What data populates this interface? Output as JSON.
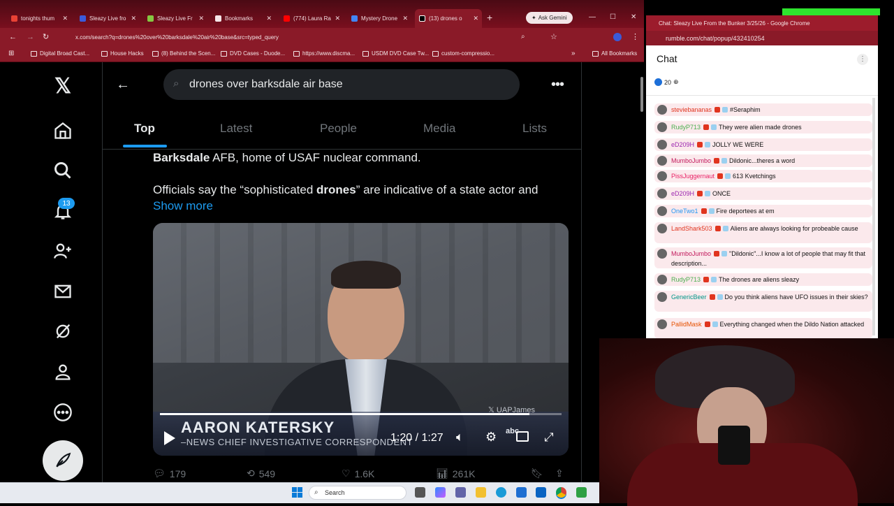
{
  "tabs": [
    {
      "label": "tonights thum",
      "color": "#e94235"
    },
    {
      "label": "Sleazy Live fro",
      "color": "#3b5bdb"
    },
    {
      "label": "Sleazy Live Fr",
      "color": "#85c742"
    },
    {
      "label": "Bookmarks",
      "color": "#f4e6e8"
    },
    {
      "label": "(774) Laura Ra",
      "color": "#ff0000"
    },
    {
      "label": "Mystery Drone",
      "color": "#4285f4"
    },
    {
      "label": "(13) drones o",
      "color": "#000000"
    }
  ],
  "ask_gemini": "Ask Gemini",
  "address": "x.com/search?q=drones%20over%20barksdale%20air%20base&src=typed_query",
  "bookmarks": [
    "Digital Broad Cast...",
    "House Hacks",
    "(8) Behind the Scen...",
    "DVD Cases - Duode...",
    "https://www.discma...",
    "USDM DVD Case Tw...",
    "custom-compressio..."
  ],
  "all_bookmarks": "All Bookmarks",
  "x": {
    "notif_count": "13",
    "search_query": "drones over barksdale air base",
    "tabs": [
      "Top",
      "Latest",
      "People",
      "Media",
      "Lists"
    ],
    "post": {
      "line1_bold": "Barksdale",
      "line1_rest": " AFB, home of USAF nuclear command.",
      "line2_a": "Officials say the “sophisticated ",
      "line2_bold": "drones",
      "line2_b": "” are indicative of a state actor and",
      "show_more": "Show more"
    },
    "video": {
      "name": "AARON KATERSKY",
      "title": "NEWS CHIEF INVESTIGATIVE CORRESPONDENT",
      "watermark": "UAPJames",
      "network": "abc",
      "time": "1:20 / 1:27",
      "progress": 0.92
    },
    "stats": {
      "replies": "179",
      "reposts": "549",
      "likes": "1.6K",
      "views": "261K"
    }
  },
  "taskbar": {
    "search": "Search"
  },
  "chat": {
    "window_title": "Chat: Sleazy Live From the Bunker 3/25/26 - Google Chrome",
    "url": "rumble.com/chat/popup/432410254",
    "heading": "Chat",
    "viewers": "20",
    "messages": [
      {
        "user": "steviebananas",
        "color": "#e0341e",
        "text": "#Seraphim"
      },
      {
        "user": "RudyP713",
        "color": "#4caf50",
        "text": "They were alien made drones"
      },
      {
        "user": "eD209H",
        "color": "#9c27b0",
        "text": "JOLLY WE WERE"
      },
      {
        "user": "MumboJumbo",
        "color": "#c2185b",
        "text": "Dildonic...theres a word"
      },
      {
        "user": "PissJuggernaut",
        "color": "#e91e63",
        "text": "613 Kvetchings"
      },
      {
        "user": "eD209H",
        "color": "#9c27b0",
        "text": "ONCE"
      },
      {
        "user": "OneTwo1",
        "color": "#2196f3",
        "text": "Fire deportees at em"
      },
      {
        "user": "LandShark503",
        "color": "#e0341e",
        "text": "Aliens are always looking for probeable cause"
      },
      {
        "user": "MumboJumbo",
        "color": "#c2185b",
        "text": "\"Dildonic\"...I know a lot of people that may fit that description..."
      },
      {
        "user": "RudyP713",
        "color": "#4caf50",
        "text": "The drones are aliens sleazy"
      },
      {
        "user": "GenericBeer",
        "color": "#009688",
        "text": "Do you think aliens have UFO issues in their skies?"
      },
      {
        "user": "PallidMask",
        "color": "#e65100",
        "text": "Everything changed when the Dildo Nation attacked"
      }
    ]
  }
}
